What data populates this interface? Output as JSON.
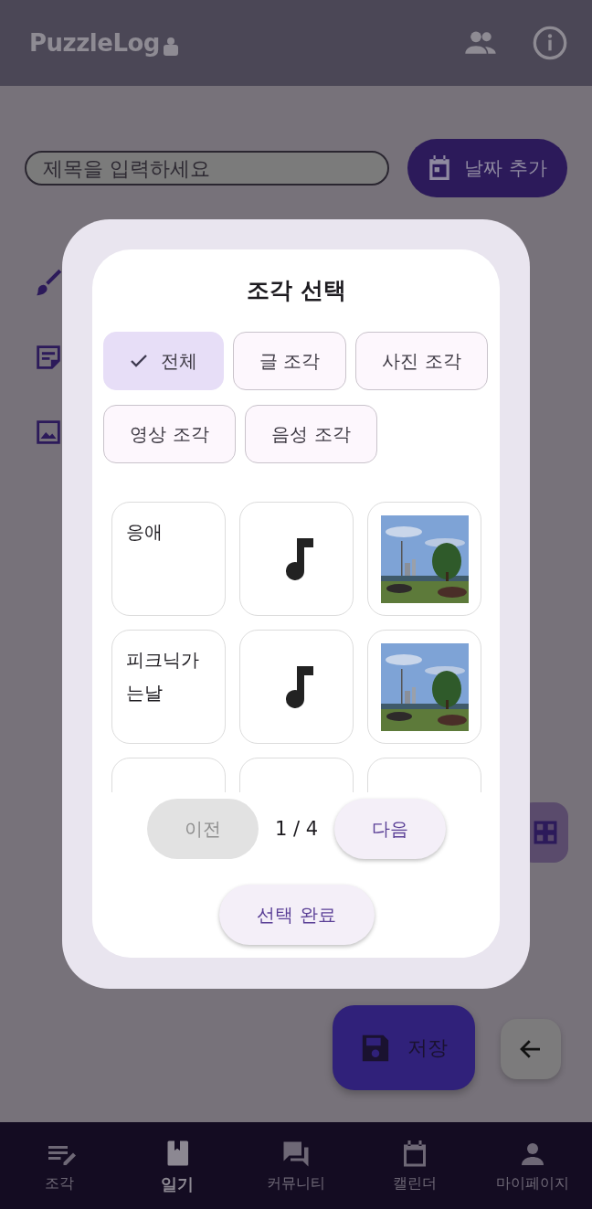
{
  "app_bar": {
    "logo": "PuzzleLog"
  },
  "title_field": {
    "placeholder": "제목을 입력하세요"
  },
  "date_button": {
    "label": "날짜 추가"
  },
  "dialog": {
    "title": "조각 선택",
    "filters": [
      {
        "label": "전체",
        "selected": true
      },
      {
        "label": "글 조각",
        "selected": false
      },
      {
        "label": "사진 조각",
        "selected": false
      },
      {
        "label": "영상 조각",
        "selected": false
      },
      {
        "label": "음성 조각",
        "selected": false
      }
    ],
    "pieces": [
      {
        "kind": "text",
        "text": "응애"
      },
      {
        "kind": "audio"
      },
      {
        "kind": "picture"
      },
      {
        "kind": "text",
        "text": "피크닉가는날"
      },
      {
        "kind": "audio"
      },
      {
        "kind": "picture"
      },
      {
        "kind": "cut"
      },
      {
        "kind": "cut"
      },
      {
        "kind": "cut"
      }
    ],
    "pager": {
      "previous": {
        "label": "이전",
        "disabled": true
      },
      "page": "1 / 4",
      "next": {
        "label": "다음",
        "disabled": false
      }
    },
    "confirm_button": {
      "label": "선택 완료"
    }
  },
  "save_button": {
    "label": "저장"
  },
  "bottom_nav": [
    {
      "label": "조각",
      "selected": false
    },
    {
      "label": "일기",
      "selected": true
    },
    {
      "label": "커뮤니티",
      "selected": false
    },
    {
      "label": "캘린더",
      "selected": false
    },
    {
      "label": "마이페이지",
      "selected": false
    }
  ]
}
